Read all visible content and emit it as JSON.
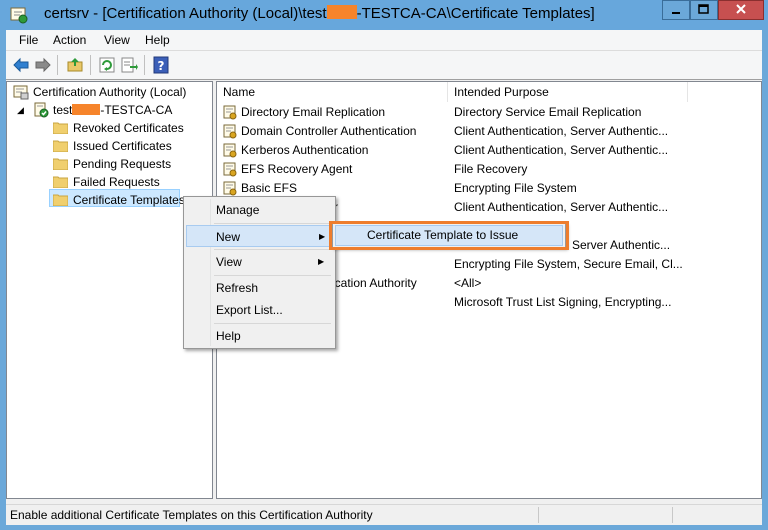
{
  "window": {
    "title_prefix": "certsrv - [Certification Authority (Local)\\test",
    "title_suffix": "-TESTCA-CA\\Certificate Templates]"
  },
  "menu": [
    "File",
    "Action",
    "View",
    "Help"
  ],
  "tree": {
    "root": "Certification Authority (Local)",
    "ca_prefix": "test",
    "ca_suffix": "-TESTCA-CA",
    "children": [
      "Revoked Certificates",
      "Issued Certificates",
      "Pending Requests",
      "Failed Requests",
      "Certificate Templates"
    ]
  },
  "list": {
    "columns": [
      "Name",
      "Intended Purpose"
    ],
    "rows": [
      {
        "name": "Directory Email Replication",
        "purpose": "Directory Service Email Replication"
      },
      {
        "name": "Domain Controller Authentication",
        "purpose": "Client Authentication, Server Authentic..."
      },
      {
        "name": "Kerberos Authentication",
        "purpose": "Client Authentication, Server Authentic..."
      },
      {
        "name": "EFS Recovery Agent",
        "purpose": "File Recovery"
      },
      {
        "name": "Basic EFS",
        "purpose": "Encrypting File System"
      },
      {
        "name": "r",
        "purpose": "Client Authentication, Server Authentic..."
      },
      {
        "name": "",
        "purpose": ""
      },
      {
        "name": "",
        "purpose": "Server Authentic..."
      },
      {
        "name": "",
        "purpose": "Encrypting File System, Secure Email, Cl..."
      },
      {
        "name": "ication Authority",
        "purpose": "<All>"
      },
      {
        "name": "",
        "purpose": "Microsoft Trust List Signing, Encrypting..."
      }
    ]
  },
  "context_menu": {
    "items": [
      "Manage",
      "New",
      "View",
      "Refresh",
      "Export List...",
      "Help"
    ]
  },
  "submenu": {
    "item": "Certificate Template to Issue"
  },
  "status": {
    "text": "Enable additional Certificate Templates on this Certification Authority"
  },
  "colors": {
    "accent_highlight": "#ee7d2d",
    "redaction": "#f6842b",
    "titlebar": "#67a7dc"
  }
}
